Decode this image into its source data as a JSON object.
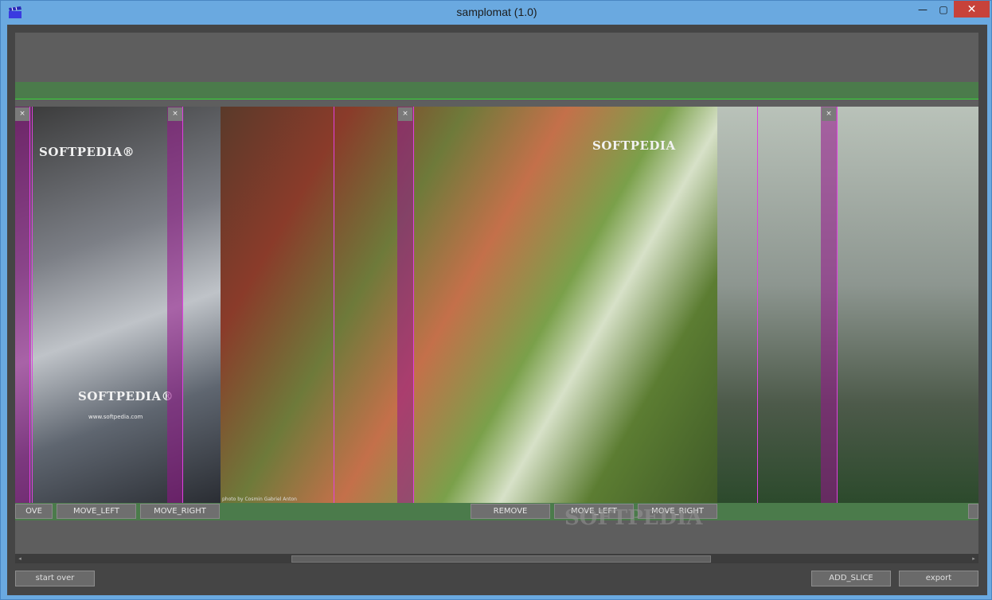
{
  "window": {
    "title": "samplomat (1.0)",
    "min_glyph": "—",
    "max_glyph": "▢",
    "close_glyph": "✕",
    "app_icon": "clapperboard-icon",
    "colors": {
      "accent_green": "#4b7b4b",
      "slice_marker": "#e040e0"
    }
  },
  "slices": [
    {
      "close_label": "×",
      "watermark_top": "SOFTPEDIA®",
      "watermark_bottom": "SOFTPEDIA®",
      "url": "www.softpedia.com"
    },
    {
      "close_label": "×",
      "watermark_top": "SOFTPEDIA",
      "credit": "photo by Cosmin Gabriel Anton"
    },
    {
      "close_label": "×"
    }
  ],
  "slice_controls": {
    "remove_partial": "OVE",
    "remove": "REMOVE",
    "move_left": "MOVE_LEFT",
    "move_right": "MOVE_RIGHT"
  },
  "watermark": "SOFTPEDIA",
  "scrollbar": {
    "left_arrow": "◂",
    "right_arrow": "▸"
  },
  "footer": {
    "start_over": "start over",
    "add_slice": "ADD_SLICE",
    "export": "export"
  }
}
